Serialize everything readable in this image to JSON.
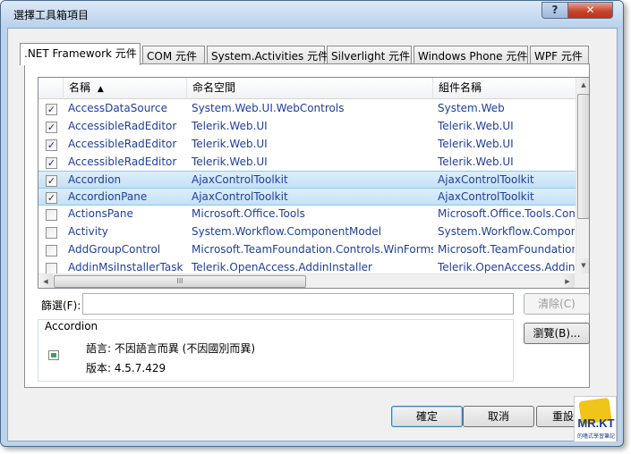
{
  "window": {
    "title": "選擇工具箱項目",
    "help_glyph": "?",
    "close_glyph": "✕"
  },
  "tabs": [
    {
      "label": ".NET Framework 元件",
      "active": true
    },
    {
      "label": "COM 元件",
      "active": false
    },
    {
      "label": "System.Activities 元件",
      "active": false
    },
    {
      "label": "Silverlight 元件",
      "active": false
    },
    {
      "label": "Windows Phone 元件",
      "active": false
    },
    {
      "label": "WPF 元件",
      "active": false
    }
  ],
  "list": {
    "columns": {
      "name": "名稱",
      "sort_glyph": "▲",
      "namespace": "命名空間",
      "assembly": "組件名稱"
    },
    "rows": [
      {
        "checked": true,
        "selected": false,
        "name": "AccessDataSource",
        "namespace": "System.Web.UI.WebControls",
        "assembly": "System.Web"
      },
      {
        "checked": true,
        "selected": false,
        "name": "AccessibleRadEditor",
        "namespace": "Telerik.Web.UI",
        "assembly": "Telerik.Web.UI"
      },
      {
        "checked": true,
        "selected": false,
        "name": "AccessibleRadEditor",
        "namespace": "Telerik.Web.UI",
        "assembly": "Telerik.Web.UI"
      },
      {
        "checked": true,
        "selected": false,
        "name": "AccessibleRadEditor",
        "namespace": "Telerik.Web.UI",
        "assembly": "Telerik.Web.UI"
      },
      {
        "checked": true,
        "selected": true,
        "name": "Accordion",
        "namespace": "AjaxControlToolkit",
        "assembly": "AjaxControlToolkit"
      },
      {
        "checked": true,
        "selected": true,
        "name": "AccordionPane",
        "namespace": "AjaxControlToolkit",
        "assembly": "AjaxControlToolkit"
      },
      {
        "checked": false,
        "selected": false,
        "name": "ActionsPane",
        "namespace": "Microsoft.Office.Tools",
        "assembly": "Microsoft.Office.Tools.Com"
      },
      {
        "checked": false,
        "selected": false,
        "name": "Activity",
        "namespace": "System.Workflow.ComponentModel",
        "assembly": "System.Workflow.Compone"
      },
      {
        "checked": false,
        "selected": false,
        "name": "AddGroupControl",
        "namespace": "Microsoft.TeamFoundation.Controls.WinForms",
        "assembly": "Microsoft.TeamFoundation"
      },
      {
        "checked": false,
        "selected": false,
        "name": "AddinMsiInstallerTask",
        "namespace": "Telerik.OpenAccess.AddinInstaller",
        "assembly": "Telerik.OpenAccess.AddinInst"
      }
    ],
    "check_glyph": "✓",
    "scroll_up_glyph": "▲",
    "scroll_down_glyph": "▼",
    "scroll_left_glyph": "◀",
    "scroll_right_glyph": "▶",
    "thumb_grip": "III"
  },
  "filter": {
    "label": "篩選(F):",
    "value": "",
    "clear_label": "清除(C)"
  },
  "info": {
    "title": "Accordion",
    "language_line": "語言: 不因語言而異 (不因國別而異)",
    "version_line": "版本: 4.5.7.429"
  },
  "buttons": {
    "browse": "瀏覽(B)...",
    "ok": "確定",
    "cancel": "取消",
    "reset": "重設"
  },
  "logo": {
    "text": "MR.KT",
    "sub": "的嗜式學習筆記"
  }
}
